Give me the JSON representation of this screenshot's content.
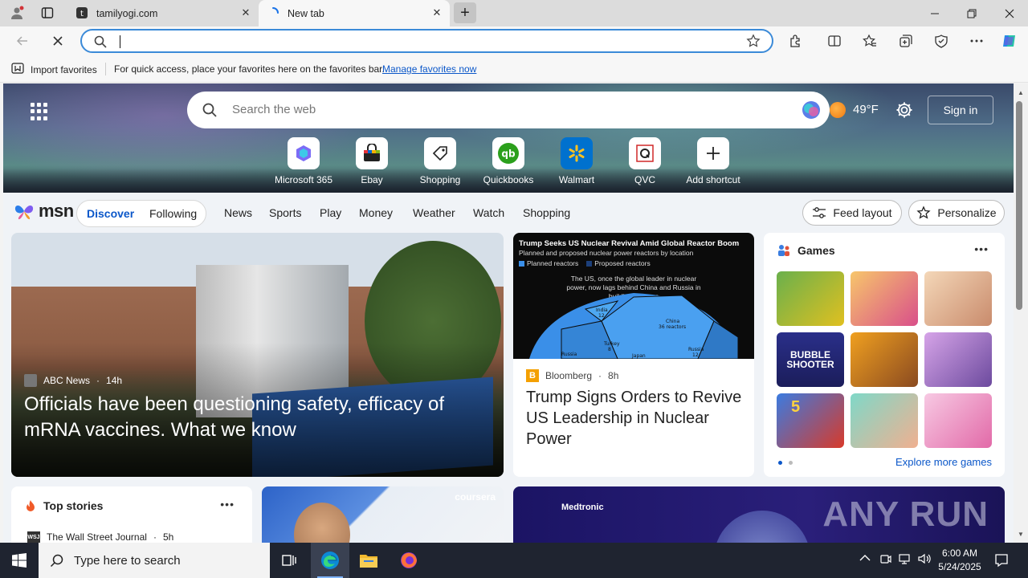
{
  "browser": {
    "tabs": [
      {
        "title": "tamilyogi.com"
      },
      {
        "title": "New tab"
      }
    ],
    "address_bar": {
      "value": "",
      "placeholder": ""
    },
    "favorites_bar": {
      "import_label": "Import favorites",
      "message": "For quick access, place your favorites here on the favorites bar.",
      "manage_link": "Manage favorites now"
    }
  },
  "newtab": {
    "search_placeholder": "Search the web",
    "weather": {
      "temp": "49°F"
    },
    "sign_in": "Sign in",
    "shortcuts": [
      {
        "label": "Microsoft 365",
        "icon": "microsoft365-icon"
      },
      {
        "label": "Ebay",
        "icon": "ebay-icon"
      },
      {
        "label": "Shopping",
        "icon": "shopping-tag-icon"
      },
      {
        "label": "Quickbooks",
        "icon": "quickbooks-icon"
      },
      {
        "label": "Walmart",
        "icon": "walmart-icon"
      },
      {
        "label": "QVC",
        "icon": "qvc-icon"
      },
      {
        "label": "Add shortcut",
        "icon": "plus-icon"
      }
    ]
  },
  "msn": {
    "logo_text": "msn",
    "tabs": {
      "discover": "Discover",
      "following": "Following"
    },
    "nav": [
      "News",
      "Sports",
      "Play",
      "Money",
      "Weather",
      "Watch",
      "Shopping"
    ],
    "feed_layout": "Feed layout",
    "personalize": "Personalize"
  },
  "cards": {
    "main": {
      "source": "ABC News",
      "age": "14h",
      "headline": "Officials have been questioning safety, efficacy of mRNA vaccines. What we know"
    },
    "bloomberg": {
      "chart_title": "Trump Seeks US Nuclear Revival Amid Global Reactor Boom",
      "chart_subtitle": "Planned and proposed nuclear power reactors by location",
      "legend": [
        "Planned reactors",
        "Proposed reactors"
      ],
      "chart_note": "The US, once the global leader in nuclear power, now lags behind China and Russia in building reactors",
      "labels": [
        {
          "name": "India",
          "value": "12"
        },
        {
          "name": "China",
          "value": "36 reactors"
        },
        {
          "name": "Turkey",
          "value": "8"
        },
        {
          "name": "Russia",
          "value": ""
        },
        {
          "name": "Japan",
          "value": ""
        },
        {
          "name": "Russia",
          "value": "12"
        }
      ],
      "source": "Bloomberg",
      "age": "8h",
      "headline": "Trump Signs Orders to Revive US Leadership in Nuclear Power"
    },
    "games": {
      "title": "Games",
      "explore": "Explore more games",
      "bubble_label": "BUBBLE SHOOTER",
      "number_label": "5"
    },
    "top_stories": {
      "title": "Top stories",
      "source": "The Wall Street Journal",
      "age": "5h"
    },
    "coursera": {
      "brand": "coursera"
    },
    "medtronic": {
      "brand": "Medtronic",
      "watermark": "ANY RUN"
    }
  },
  "taskbar": {
    "search_placeholder": "Type here to search",
    "time": "6:00 AM",
    "date": "5/24/2025"
  }
}
